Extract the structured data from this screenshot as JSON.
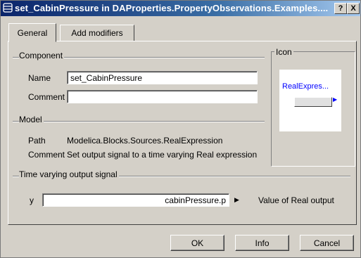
{
  "window": {
    "title": "set_CabinPressure in DAProperties.PropertyObservations.Examples....",
    "help_label": "?",
    "close_label": "X"
  },
  "tabs": [
    {
      "label": "General",
      "active": true
    },
    {
      "label": "Add modifiers",
      "active": false
    }
  ],
  "component": {
    "group_label": "Component",
    "name_label": "Name",
    "name_value": "set_CabinPressure",
    "comment_label": "Comment",
    "comment_value": ""
  },
  "icon": {
    "group_label": "Icon",
    "preview_text": "RealExpres..."
  },
  "model": {
    "group_label": "Model",
    "path_label": "Path",
    "path_value": "Modelica.Blocks.Sources.RealExpression",
    "comment_label": "Comment",
    "comment_value": "Set output signal to a time varying Real expression"
  },
  "signal": {
    "group_label": "Time varying output signal",
    "param_label": "y",
    "param_value": "cabinPressure.p",
    "param_description": "Value of Real output"
  },
  "buttons": {
    "ok": "OK",
    "info": "Info",
    "cancel": "Cancel"
  },
  "colors": {
    "title_bar": "#0a246a",
    "dialog_face": "#d4d0c8",
    "icon_text": "#0000ff"
  }
}
